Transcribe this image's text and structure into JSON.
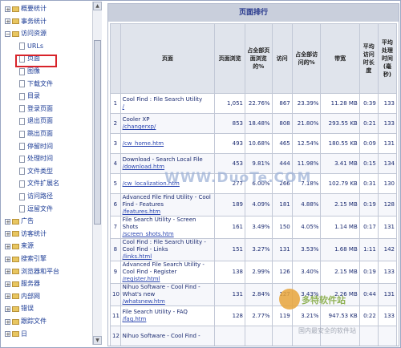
{
  "tree": [
    {
      "label": "概要统计",
      "type": "folder",
      "pm": "+"
    },
    {
      "label": "事务统计",
      "type": "folder",
      "pm": "+"
    },
    {
      "label": "访问资源",
      "type": "folder",
      "pm": "−"
    },
    {
      "label": "URLs",
      "type": "doc"
    },
    {
      "label": "页面",
      "type": "doc",
      "selected": true
    },
    {
      "label": "图像",
      "type": "doc"
    },
    {
      "label": "下载文件",
      "type": "doc"
    },
    {
      "label": "目录",
      "type": "doc"
    },
    {
      "label": "登录页面",
      "type": "doc"
    },
    {
      "label": "退出页面",
      "type": "doc"
    },
    {
      "label": "跳出页面",
      "type": "doc"
    },
    {
      "label": "停留时间",
      "type": "doc"
    },
    {
      "label": "处理时间",
      "type": "doc"
    },
    {
      "label": "文件类型",
      "type": "doc"
    },
    {
      "label": "文件扩展名",
      "type": "doc"
    },
    {
      "label": "访问路径",
      "type": "doc"
    },
    {
      "label": "逗留文件",
      "type": "doc"
    },
    {
      "label": "广告",
      "type": "folder",
      "pm": "+"
    },
    {
      "label": "访客统计",
      "type": "folder",
      "pm": "+"
    },
    {
      "label": "来源",
      "type": "folder",
      "pm": "+"
    },
    {
      "label": "搜索引擎",
      "type": "folder",
      "pm": "+"
    },
    {
      "label": "浏览器和平台",
      "type": "folder",
      "pm": "+"
    },
    {
      "label": "服务器",
      "type": "folder",
      "pm": "+"
    },
    {
      "label": "内部网",
      "type": "folder",
      "pm": "+"
    },
    {
      "label": "错误",
      "type": "folder",
      "pm": "+"
    },
    {
      "label": "跟踪文件",
      "type": "folder",
      "pm": "+"
    },
    {
      "label": "日",
      "type": "folder",
      "pm": "+"
    }
  ],
  "panel_title": "页面排行",
  "columns": [
    "",
    "页面",
    "页面浏览",
    "占全部页面浏览的%",
    "访问",
    "占全部访问的%",
    "带宽",
    "平均访问时长度",
    "平均处理时间(毫秒)"
  ],
  "rows": [
    {
      "n": "1",
      "title": "Cool Find : File Search Utility",
      "url": "/",
      "pv": "1,051",
      "pvp": "22.76%",
      "v": "867",
      "vp": "23.39%",
      "bw": "11.28 MB",
      "t": "0:39",
      "p": "133"
    },
    {
      "n": "2",
      "title": "Cooler XP",
      "url": "/changerxp/",
      "pv": "853",
      "pvp": "18.48%",
      "v": "808",
      "vp": "21.80%",
      "bw": "293.55 KB",
      "t": "0:21",
      "p": "133"
    },
    {
      "n": "3",
      "title": "",
      "url": "/cw_home.htm",
      "pv": "493",
      "pvp": "10.68%",
      "v": "465",
      "vp": "12.54%",
      "bw": "180.55 KB",
      "t": "0:09",
      "p": "131"
    },
    {
      "n": "4",
      "title": "Download - Search Local File",
      "url": "/download.htm",
      "pv": "453",
      "pvp": "9.81%",
      "v": "444",
      "vp": "11.98%",
      "bw": "3.41 MB",
      "t": "0:15",
      "p": "134"
    },
    {
      "n": "5",
      "title": "",
      "url": "/cw_localization.htm",
      "pv": "277",
      "pvp": "6.00%",
      "v": "266",
      "vp": "7.18%",
      "bw": "102.79 KB",
      "t": "0:31",
      "p": "130"
    },
    {
      "n": "6",
      "title": "Advanced File Find Utility - Cool Find - Features",
      "url": "/features.htm",
      "pv": "189",
      "pvp": "4.09%",
      "v": "181",
      "vp": "4.88%",
      "bw": "2.15 MB",
      "t": "0:19",
      "p": "128"
    },
    {
      "n": "7",
      "title": "File Search Utility - Screen Shots",
      "url": "/screen_shots.htm",
      "pv": "161",
      "pvp": "3.49%",
      "v": "150",
      "vp": "4.05%",
      "bw": "1.14 MB",
      "t": "0:17",
      "p": "131"
    },
    {
      "n": "8",
      "title": "Cool Find : File Search Utility - Cool Find - Links",
      "url": "/links.html",
      "pv": "151",
      "pvp": "3.27%",
      "v": "131",
      "vp": "3.53%",
      "bw": "1.68 MB",
      "t": "1:11",
      "p": "142"
    },
    {
      "n": "9",
      "title": "Advanced File Search Utility - Cool Find - Register",
      "url": "/register.html",
      "pv": "138",
      "pvp": "2.99%",
      "v": "126",
      "vp": "3.40%",
      "bw": "2.15 MB",
      "t": "0:19",
      "p": "133"
    },
    {
      "n": "10",
      "title": "Nihuo Software - Cool Find - What's new",
      "url": "/whatsnew.htm",
      "pv": "131",
      "pvp": "2.84%",
      "v": "127",
      "vp": "3.43%",
      "bw": "2.26 MB",
      "t": "0:44",
      "p": "131"
    },
    {
      "n": "11",
      "title": "File Search Utility - FAQ",
      "url": "/faq.htm",
      "pv": "128",
      "pvp": "2.77%",
      "v": "119",
      "vp": "3.21%",
      "bw": "947.53 KB",
      "t": "0:22",
      "p": "133"
    },
    {
      "n": "12",
      "title": "Nihuo Software - Cool Find -",
      "url": "",
      "pv": "",
      "pvp": "",
      "v": "",
      "vp": "",
      "bw": "",
      "t": "",
      "p": ""
    }
  ],
  "watermarks": {
    "site": "WWW.DuoTe.COM",
    "brand": "多特软件站",
    "slogan": "国内最安全的软件站"
  },
  "colors": {
    "title_bar": "#c9cfdc",
    "header": "#e0e4ec",
    "selected_outline": "#d8232a",
    "link": "#2a45b0"
  }
}
